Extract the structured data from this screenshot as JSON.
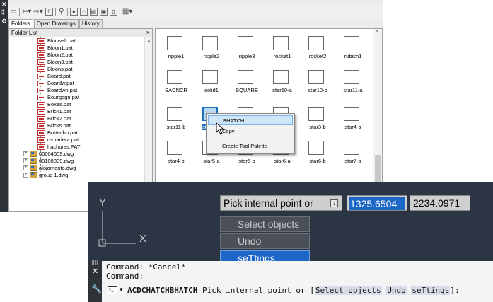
{
  "design_center": {
    "tabs": [
      "Folders",
      "Open Drawings",
      "History"
    ],
    "folder_list_title": "Folder List",
    "close_glyph": "×",
    "pat_files": [
      "Blocwall.pat",
      "Bloon1.pat",
      "Bloon2.pat",
      "Bloon3.pat",
      "Bloons.pat",
      "Board.pat",
      "Boardw.pat",
      "Boardwn.pat",
      "Bourgogn.pat",
      "Boxes.pat",
      "Brick1.pat",
      "Brick2.pat",
      "Bricks.pat",
      "Buttedhb.pat",
      "c-madera.pat",
      "hachuras.PAT"
    ],
    "dwg_files": [
      "00004609.dwg",
      "00108839.dwg",
      "alojamento.dwg",
      "group 1.dwg"
    ],
    "patterns": [
      {
        "name": "ripple1",
        "style": "p-ripple"
      },
      {
        "name": "ripple2",
        "style": "p-ripple2"
      },
      {
        "name": "ripple3",
        "style": "p-ripple2"
      },
      {
        "name": "rocket1",
        "style": "p-rocket"
      },
      {
        "name": "rocket2",
        "style": "p-rocket2"
      },
      {
        "name": "rubish1",
        "style": "p-square"
      },
      {
        "name": "SACNCR",
        "style": "p-sacncr"
      },
      {
        "name": "solid1",
        "style": "p-solid"
      },
      {
        "name": "SQUARE",
        "style": "p-square"
      },
      {
        "name": "star10-a",
        "style": "p-cross"
      },
      {
        "name": "star10-b",
        "style": "p-star"
      },
      {
        "name": "star11-a",
        "style": "p-cross"
      },
      {
        "name": "star11-b",
        "style": "p-star"
      },
      {
        "name": "star",
        "style": "p-cross"
      },
      {
        "name": "",
        "style": "p-hexa"
      },
      {
        "name": "",
        "style": "p-dots"
      },
      {
        "name": "star3-b",
        "style": "p-dots"
      },
      {
        "name": "star4-a",
        "style": "p-square"
      },
      {
        "name": "star4-b",
        "style": "p-check"
      },
      {
        "name": "star5-a",
        "style": "p-cross"
      },
      {
        "name": "star5-b",
        "style": "p-hexa"
      },
      {
        "name": "star6-a",
        "style": "p-dots"
      },
      {
        "name": "star6-b",
        "style": "p-check"
      },
      {
        "name": "star7-a",
        "style": "p-cross"
      }
    ],
    "context_menu": {
      "items": [
        "BHATCH...",
        "Copy",
        "Create Tool Palette"
      ]
    }
  },
  "drawing": {
    "ucs_y": "Y",
    "ucs_x": "X",
    "prompt": "Pick internal point or",
    "prompt_dropdown": "↓",
    "coord_x": "1325.6504",
    "coord_y": "2234.0971",
    "options": [
      "Select objects",
      "Undo",
      "seTtings"
    ]
  },
  "command": {
    "history": [
      "Command: *Cancel*",
      "Command:"
    ],
    "command_name": "ACDCHATCHBHATCH",
    "prompt_text": " Pick internal point or [",
    "options": [
      "Select objects",
      "Undo",
      "seTtings"
    ],
    "suffix": "]:"
  }
}
